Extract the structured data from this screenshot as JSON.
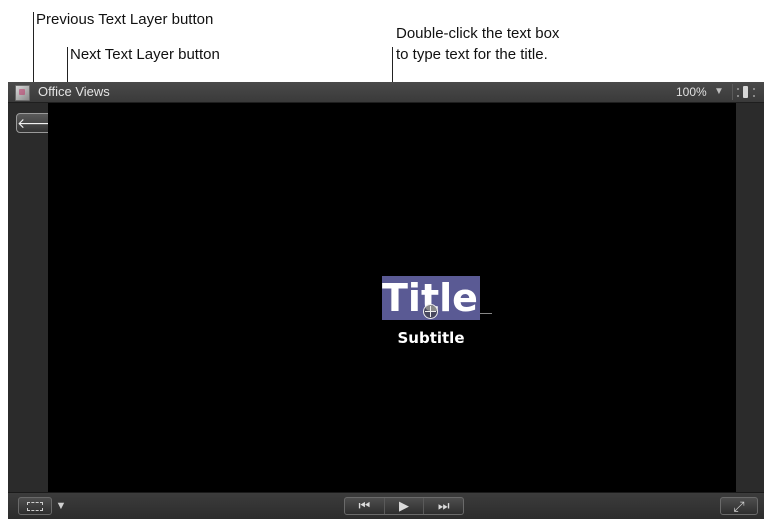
{
  "callouts": {
    "previous_layer": "Previous Text Layer button",
    "next_layer": "Next Text Layer button",
    "double_click_line1": "Double-click the text box",
    "double_click_line2": "to type text for the title."
  },
  "viewer": {
    "project_name": "Office Views",
    "zoom": "100%",
    "zoom_arrow": "▼"
  },
  "canvas": {
    "title": "Title",
    "subtitle": "Subtitle"
  },
  "nav": {
    "previous_glyph": "🡐",
    "next_glyph": "🡒"
  },
  "transport": {
    "go_to_start": "⏮",
    "play": "▶",
    "go_to_end": "⏭"
  },
  "bottom": {
    "layout_arrow": "▼",
    "fullscreen_glyph": "⤢"
  }
}
